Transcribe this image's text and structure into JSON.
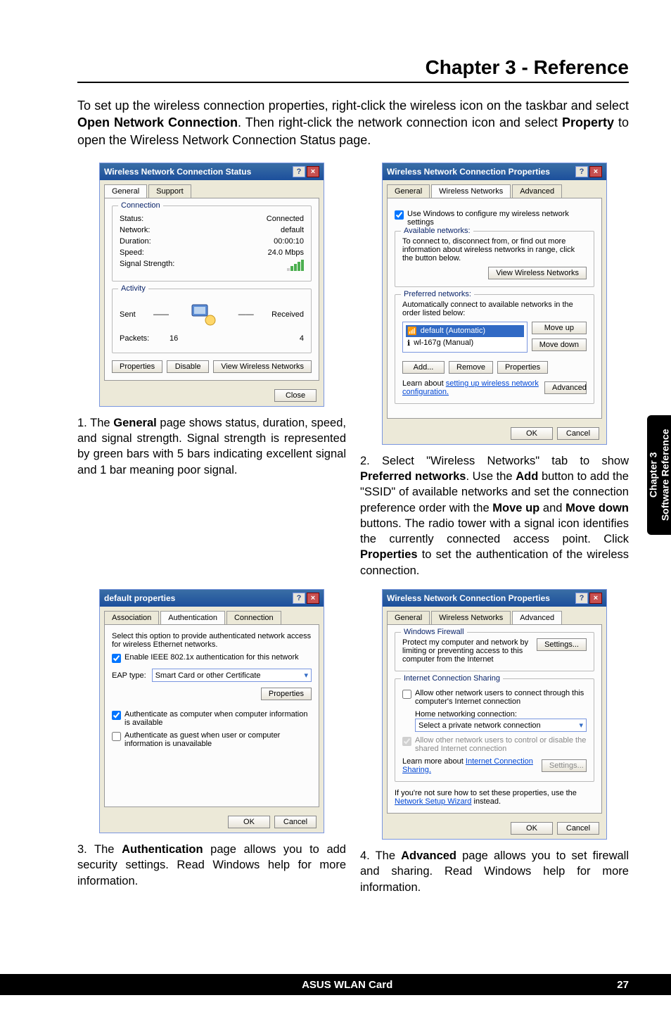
{
  "header": {
    "chapter_title": "Chapter 3 - Reference"
  },
  "intro": "To set up the wireless connection properties, right-click the wireless icon on the taskbar and select Open Network Connection. Then right-click the network connection icon and select Property to open the Wireless Network Connection Status page.",
  "intro_bold_1": "Open Network Connection",
  "intro_bold_2": "Property",
  "status_dialog": {
    "title": "Wireless Network Connection Status",
    "tabs": [
      "General",
      "Support"
    ],
    "connection_label": "Connection",
    "rows": {
      "status_l": "Status:",
      "status_v": "Connected",
      "network_l": "Network:",
      "network_v": "default",
      "duration_l": "Duration:",
      "duration_v": "00:00:10",
      "speed_l": "Speed:",
      "speed_v": "24.0 Mbps",
      "signal_l": "Signal Strength:"
    },
    "activity_label": "Activity",
    "sent": "Sent",
    "received": "Received",
    "packets_l": "Packets:",
    "packets_sent": "16",
    "packets_recv": "4",
    "buttons": {
      "properties": "Properties",
      "disable": "Disable",
      "view": "View Wireless Networks",
      "close": "Close"
    }
  },
  "desc1": "1. The General page shows status, duration, speed, and signal strength. Signal strength is represented by green bars with 5 bars indicating excellent signal and 1 bar meaning poor signal.",
  "props_dialog": {
    "title": "Wireless Network Connection Properties",
    "tabs": [
      "General",
      "Wireless Networks",
      "Advanced"
    ],
    "use_windows": "Use Windows to configure my wireless network settings",
    "avail_label": "Available networks:",
    "avail_text": "To connect to, disconnect from, or find out more information about wireless networks in range, click the button below.",
    "view_btn": "View Wireless Networks",
    "pref_label": "Preferred networks:",
    "pref_text": "Automatically connect to available networks in the order listed below:",
    "net1": "default (Automatic)",
    "net2": "wl-167g (Manual)",
    "moveup": "Move up",
    "movedown": "Move down",
    "add": "Add...",
    "remove": "Remove",
    "props": "Properties",
    "learn": "Learn about ",
    "learn_link": "setting up wireless network configuration.",
    "advanced": "Advanced",
    "ok": "OK",
    "cancel": "Cancel"
  },
  "desc2": "2. Select \"Wireless Networks\" tab to show Preferred networks. Use the Add button to add the \"SSID\" of available networks and set the connection preference order with the Move up and Move down buttons. The radio tower with a signal icon identifies the currently connected access point. Click Properties to set the authentication of the wireless connection.",
  "auth_dialog": {
    "title": "default properties",
    "tabs": [
      "Association",
      "Authentication",
      "Connection"
    ],
    "intro": "Select this option to provide authenticated network access for wireless Ethernet networks.",
    "enable": "Enable IEEE 802.1x authentication for this network",
    "eap_l": "EAP type:",
    "eap_v": "Smart Card or other Certificate",
    "props": "Properties",
    "auth_comp": "Authenticate as computer when computer information is available",
    "auth_guest": "Authenticate as guest when user or computer information is unavailable",
    "ok": "OK",
    "cancel": "Cancel"
  },
  "desc3": "3. The Authentication page allows you to add security settings. Read Windows help for more information.",
  "adv_dialog": {
    "title": "Wireless Network Connection Properties",
    "tabs": [
      "General",
      "Wireless Networks",
      "Advanced"
    ],
    "fw_label": "Windows Firewall",
    "fw_text": "Protect my computer and network by limiting or preventing access to this computer from the Internet",
    "fw_btn": "Settings...",
    "ics_label": "Internet Connection Sharing",
    "ics_allow": "Allow other network users to connect through this computer's Internet connection",
    "home_l": "Home networking connection:",
    "home_v": "Select a private network connection",
    "ics_control": "Allow other network users to control or disable the shared Internet connection",
    "learn": "Learn more about ",
    "learn_link": "Internet Connection Sharing.",
    "settings2": "Settings...",
    "hint": "If you're not sure how to set these properties, use the ",
    "hint_link": "Network Setup Wizard",
    "hint_end": " instead.",
    "ok": "OK",
    "cancel": "Cancel"
  },
  "desc4": "4. The Advanced page allows you to set firewall and sharing. Read Windows help for more information.",
  "sidebar": {
    "line1": "Chapter 3",
    "line2": "Software Reference"
  },
  "footer": {
    "center": "ASUS WLAN Card",
    "page": "27"
  }
}
